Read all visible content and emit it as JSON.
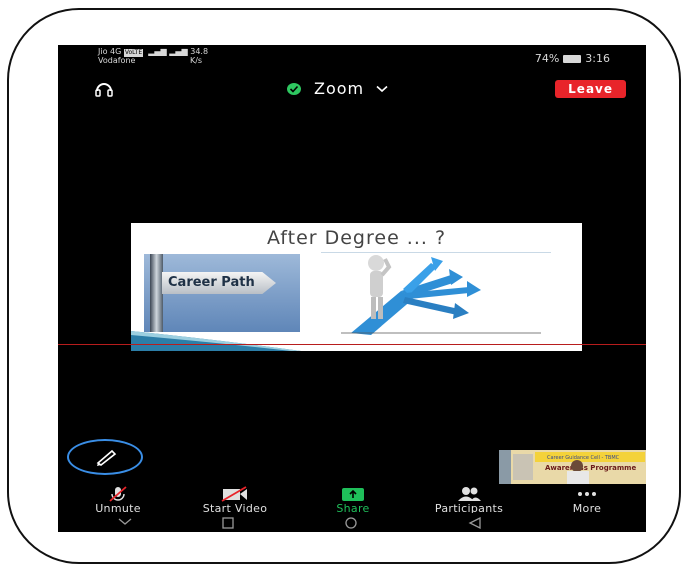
{
  "status_bar": {
    "carrier1": "Jio 4G",
    "volte": "VoLTE",
    "carrier2": "Vodafone",
    "speed": "34.8",
    "speed_unit": "K/s",
    "battery": "74%",
    "time": "3:16"
  },
  "top_bar": {
    "meeting_title": "Zoom",
    "leave_label": "Leave"
  },
  "shared_screen": {
    "title": "After Degree ... ?",
    "sign_text": "Career Path"
  },
  "thumbnail": {
    "banner_text_1": "Career Guidance Cell - TBMC",
    "banner_text_2": "Awareness Programme"
  },
  "toolbar": {
    "unmute_label": "Unmute",
    "start_video_label": "Start Video",
    "share_label": "Share",
    "participants_label": "Participants",
    "more_label": "More"
  },
  "colors": {
    "leave_bg": "#e8242a",
    "share_green": "#1fbf5a",
    "annotate_ring": "#3a8ee6"
  },
  "icons": [
    "headset-icon",
    "shield-check-icon",
    "chevron-down-icon",
    "pencil-icon",
    "mic-muted-icon",
    "video-off-icon",
    "share-arrow-icon",
    "participants-icon",
    "more-dots-icon",
    "nav-back-icon",
    "nav-home-icon",
    "nav-recents-icon",
    "nav-down-icon"
  ]
}
